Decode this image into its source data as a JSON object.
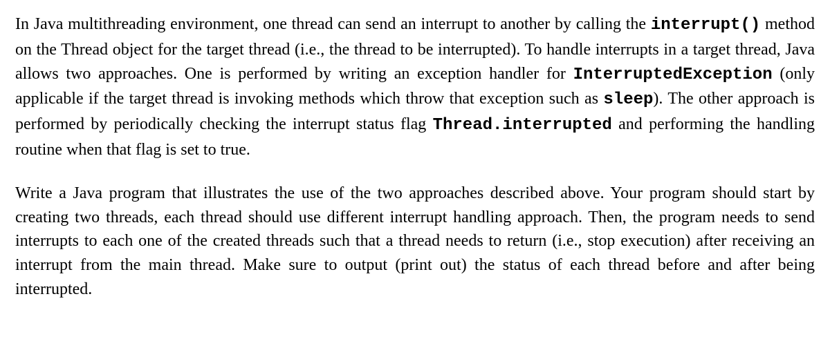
{
  "paragraphs": [
    {
      "parts": [
        {
          "text": "In Java multithreading environment, one thread can send an interrupt to another by calling the ",
          "code": false
        },
        {
          "text": "interrupt()",
          "code": true
        },
        {
          "text": " method on the Thread object for the target thread (i.e., the thread to be interrupted). To handle interrupts in a target thread, Java allows two approaches. One is performed by writing an exception handler for ",
          "code": false
        },
        {
          "text": "InterruptedException",
          "code": true
        },
        {
          "text": " (only applicable if the target thread is invoking methods which throw that exception such as ",
          "code": false
        },
        {
          "text": "sleep",
          "code": true
        },
        {
          "text": "). The other approach is performed by periodically checking the interrupt status flag ",
          "code": false
        },
        {
          "text": "Thread.interrupted",
          "code": true
        },
        {
          "text": " and performing the handling routine when that flag is set to true.",
          "code": false
        }
      ]
    },
    {
      "parts": [
        {
          "text": "Write a Java program that illustrates the use of the two approaches described above. Your program should start by creating two threads, each thread should use different interrupt handling approach. Then, the program needs to send interrupts to each one of the created threads such that a thread needs to return (i.e., stop execution) after receiving an interrupt from the main thread. Make sure to output (print out) the status of each thread before and after being interrupted.",
          "code": false
        }
      ]
    }
  ]
}
